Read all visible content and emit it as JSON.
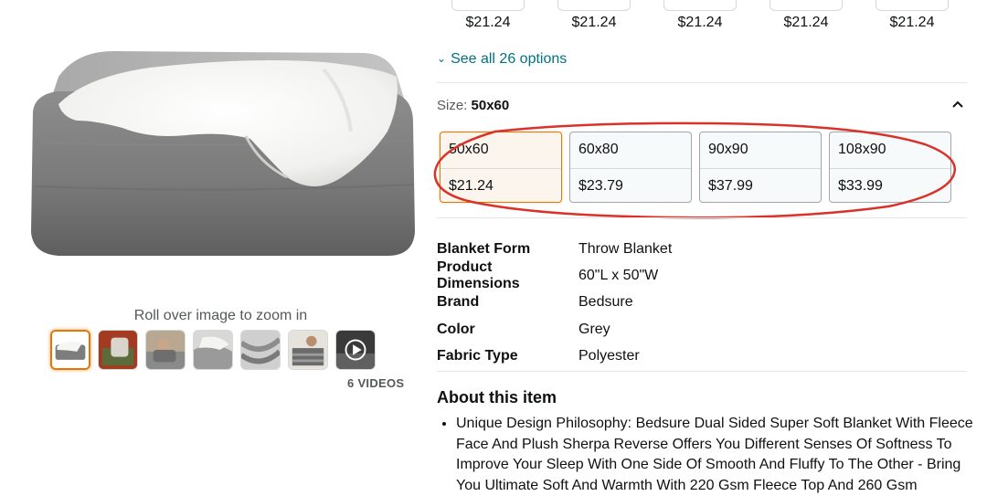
{
  "gallery": {
    "zoom_hint": "Roll over image to zoom in",
    "videos_label": "6 VIDEOS",
    "thumbnail_count": 7
  },
  "styles": {
    "swatches": [
      {
        "price": "$21.24",
        "color": "#2f2f2f"
      },
      {
        "price": "$21.24",
        "color": "#ffffff"
      },
      {
        "price": "$21.24",
        "color": "#b88a62"
      },
      {
        "price": "$21.24",
        "color": "#c89a70"
      },
      {
        "price": "$21.24",
        "color": "#333333"
      }
    ],
    "see_all_label": "See all 26 options"
  },
  "size": {
    "label": "Size:",
    "selected": "50x60",
    "options": [
      {
        "name": "50x60",
        "price": "$21.24",
        "selected": true
      },
      {
        "name": "60x80",
        "price": "$23.79",
        "selected": false
      },
      {
        "name": "90x90",
        "price": "$37.99",
        "selected": false
      },
      {
        "name": "108x90",
        "price": "$33.99",
        "selected": false
      }
    ]
  },
  "specs": [
    {
      "key": "Blanket Form",
      "value": "Throw Blanket"
    },
    {
      "key": "Product Dimensions",
      "value": "60\"L x 50\"W"
    },
    {
      "key": "Brand",
      "value": "Bedsure"
    },
    {
      "key": "Color",
      "value": "Grey"
    },
    {
      "key": "Fabric Type",
      "value": "Polyester"
    }
  ],
  "about": {
    "title": "About this item",
    "bullets": [
      "Unique Design Philosophy: Bedsure Dual Sided Super Soft Blanket With Fleece Face And Plush Sherpa Reverse Offers You Different Senses Of Softness To Improve Your Sleep With One Side Of Smooth And Fluffy To The Other - Bring You Ultimate Soft And Warmth With 220 Gsm Fleece Top And 260 Gsm"
    ]
  },
  "colors": {
    "link": "#007185",
    "selected_border": "#e77600",
    "annotation_red": "#d9322a"
  }
}
